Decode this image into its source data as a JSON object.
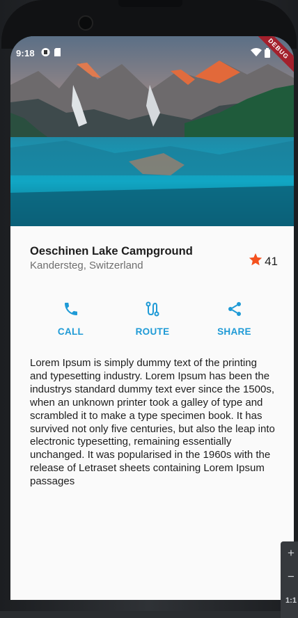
{
  "status_bar": {
    "time": "9:18",
    "icons": [
      "sim-card-icon",
      "sd-card-icon"
    ],
    "right_icons": [
      "wifi-icon",
      "battery-icon"
    ]
  },
  "debug_banner": "DEBUG",
  "place": {
    "title": "Oeschinen Lake Campground",
    "location": "Kandersteg, Switzerland",
    "rating_count": "41",
    "star_color": "#f4511e"
  },
  "actions": [
    {
      "label": "CALL",
      "icon": "phone-icon"
    },
    {
      "label": "ROUTE",
      "icon": "route-icon"
    },
    {
      "label": "SHARE",
      "icon": "share-icon"
    }
  ],
  "accent_color": "#1e9ad6",
  "description": "Lorem Ipsum is simply dummy text of the printing and typesetting industry. Lorem Ipsum has been the industrys standard dummy text ever since the 1500s, when an unknown printer took a galley of type and scrambled it to make a type specimen book. It has survived not only five centuries, but also the leap into electronic typesetting, remaining essentially unchanged. It was popularised in the 1960s with the release of Letraset sheets containing Lorem Ipsum passages",
  "emulator_controls": {
    "zoom_in": "+",
    "zoom_out": "−",
    "ratio": "1:1"
  }
}
